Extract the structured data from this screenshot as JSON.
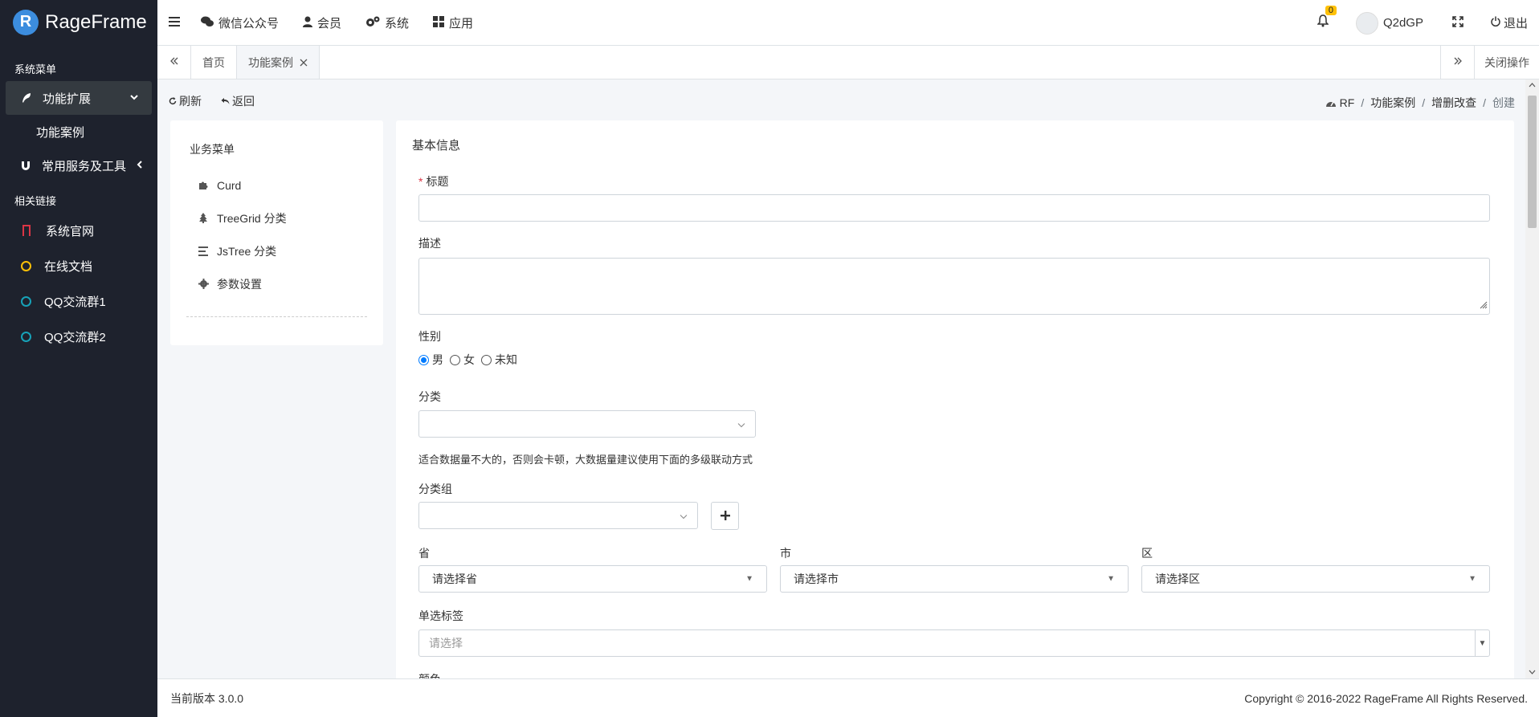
{
  "brand": {
    "name": "RageFrame",
    "mark": "R"
  },
  "sidebar": {
    "section_system": "系统菜单",
    "menu_ext": "功能扩展",
    "sub_case": "功能案例",
    "menu_tools": "常用服务及工具",
    "section_links": "相关链接",
    "links": [
      {
        "label": "系统官网",
        "color": "#dc3545"
      },
      {
        "label": "在线文档",
        "color": "#ffc107"
      },
      {
        "label": "QQ交流群1",
        "color": "#17a2b8"
      },
      {
        "label": "QQ交流群2",
        "color": "#17a2b8"
      }
    ]
  },
  "topbar": {
    "wechat": "微信公众号",
    "member": "会员",
    "system": "系统",
    "apps": "应用",
    "badge": "0",
    "user": "Q2dGP",
    "logout": "退出"
  },
  "tabs": {
    "home": "首页",
    "active": "功能案例",
    "close_ops": "关闭操作"
  },
  "content_header": {
    "refresh": "刷新",
    "back": "返回",
    "breadcrumb": [
      "RF",
      "功能案例",
      "增删改查",
      "创建"
    ]
  },
  "left_menu": {
    "title": "业务菜单",
    "items": [
      {
        "label": "Curd"
      },
      {
        "label": "TreeGrid 分类"
      },
      {
        "label": "JsTree 分类"
      },
      {
        "label": "参数设置"
      }
    ]
  },
  "form": {
    "title": "基本信息",
    "title_label": "标题",
    "desc_label": "描述",
    "gender_label": "性别",
    "gender_options": [
      "男",
      "女",
      "未知"
    ],
    "gender_selected": "男",
    "cate_label": "分类",
    "cate_help": "适合数据量不大的，否则会卡顿，大数据量建议使用下面的多级联动方式",
    "cate_group_label": "分类组",
    "province_label": "省",
    "province_value": "请选择省",
    "city_label": "市",
    "city_value": "请选择市",
    "area_label": "区",
    "area_value": "请选择区",
    "tag_label": "单选标签",
    "tag_placeholder": "请选择",
    "next_label": "颜色"
  },
  "footer": {
    "version": "当前版本 3.0.0",
    "copyright": "Copyright © 2016-2022 RageFrame All Rights Reserved."
  }
}
